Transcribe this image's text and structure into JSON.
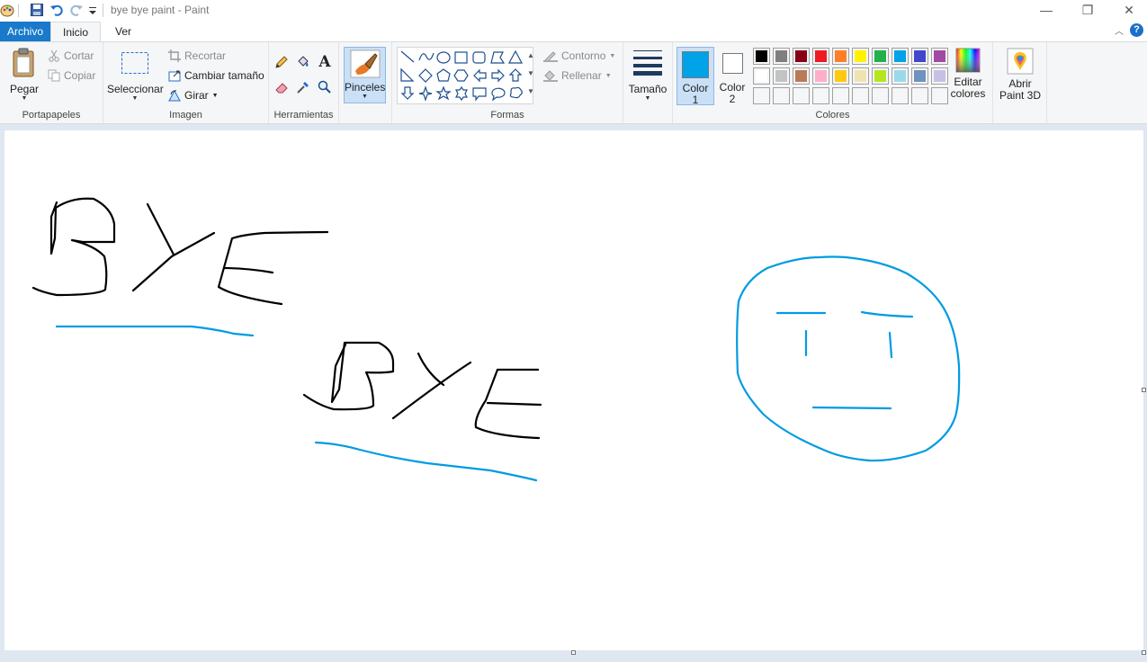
{
  "window": {
    "title": "bye bye paint - Paint",
    "controls": {
      "minimize": "—",
      "maximize": "❐",
      "close": "✕"
    }
  },
  "menu": {
    "file": "Archivo",
    "tabs": [
      {
        "label": "Inicio",
        "active": true
      },
      {
        "label": "Ver",
        "active": false
      }
    ]
  },
  "ribbon": {
    "portapapeles": {
      "label": "Portapapeles",
      "paste": "Pegar",
      "cut": "Cortar",
      "copy": "Copiar"
    },
    "imagen": {
      "label": "Imagen",
      "select": "Seleccionar",
      "crop": "Recortar",
      "resize": "Cambiar tamaño",
      "rotate": "Girar"
    },
    "herramientas": {
      "label": "Herramientas"
    },
    "pinceles": {
      "label": "Pinceles"
    },
    "formas": {
      "label": "Formas",
      "outline": "Contorno",
      "fill": "Rellenar"
    },
    "tamano": {
      "label": "Tamaño"
    },
    "colores": {
      "label": "Colores",
      "color1_label": "Color",
      "color1_num": "1",
      "color2_label": "Color",
      "color2_num": "2",
      "color1_value": "#00a2e8",
      "color2_value": "#ffffff",
      "edit_colors_line1": "Editar",
      "edit_colors_line2": "colores",
      "palette_row1": [
        "#000000",
        "#7f7f7f",
        "#880015",
        "#ed1c24",
        "#ff7f27",
        "#fff200",
        "#22b14c",
        "#00a2e8",
        "#3f48cc",
        "#a349a4"
      ],
      "palette_row2": [
        "#ffffff",
        "#c3c3c3",
        "#b97a57",
        "#ffaec9",
        "#ffc90e",
        "#efe4b0",
        "#b5e61d",
        "#99d9ea",
        "#7092be",
        "#c8bfe7"
      ],
      "palette_row3": [
        "#ffffff",
        "#ffffff",
        "#ffffff",
        "#ffffff",
        "#ffffff",
        "#ffffff",
        "#ffffff",
        "#ffffff",
        "#ffffff",
        "#ffffff"
      ]
    },
    "paint3d": {
      "line1": "Abrir",
      "line2": "Paint 3D"
    }
  }
}
